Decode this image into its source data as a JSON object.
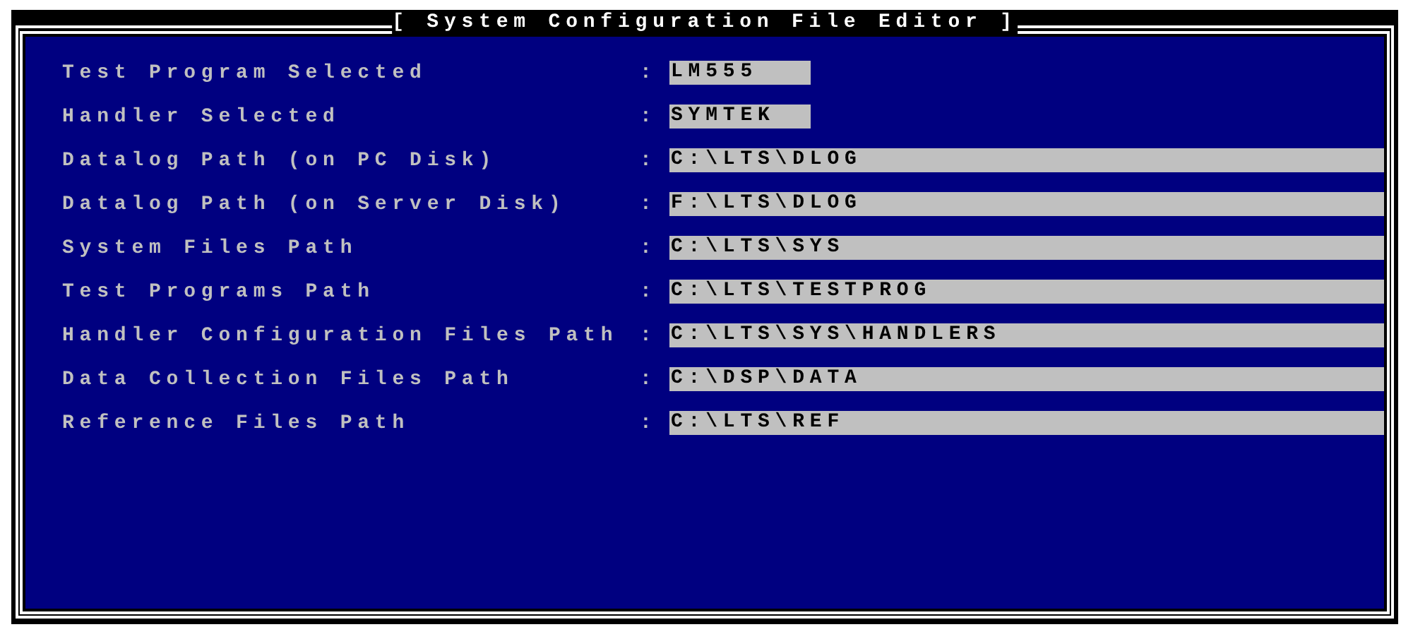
{
  "window": {
    "title": "[ System Configuration File Editor ]"
  },
  "fields": [
    {
      "label": "Test Program Selected",
      "separator": ":",
      "value": "LM555",
      "kind": "short"
    },
    {
      "label": "Handler Selected",
      "separator": ":",
      "value": "SYMTEK",
      "kind": "short"
    },
    {
      "label": "Datalog Path (on PC Disk)",
      "separator": ":",
      "value": "C:\\LTS\\DLOG",
      "kind": "long"
    },
    {
      "label": "Datalog Path (on Server Disk)",
      "separator": ":",
      "value": "F:\\LTS\\DLOG",
      "kind": "long"
    },
    {
      "label": "System Files Path",
      "separator": ":",
      "value": "C:\\LTS\\SYS",
      "kind": "long"
    },
    {
      "label": "Test Programs Path",
      "separator": ":",
      "value": "C:\\LTS\\TESTPROG",
      "kind": "long"
    },
    {
      "label": "Handler Configuration Files Path",
      "separator": ":",
      "value": "C:\\LTS\\SYS\\HANDLERS",
      "kind": "long"
    },
    {
      "label": "Data Collection Files Path",
      "separator": ":",
      "value": "C:\\DSP\\DATA",
      "kind": "long"
    },
    {
      "label": "Reference Files Path",
      "separator": ":",
      "value": "C:\\LTS\\REF",
      "kind": "long"
    }
  ]
}
